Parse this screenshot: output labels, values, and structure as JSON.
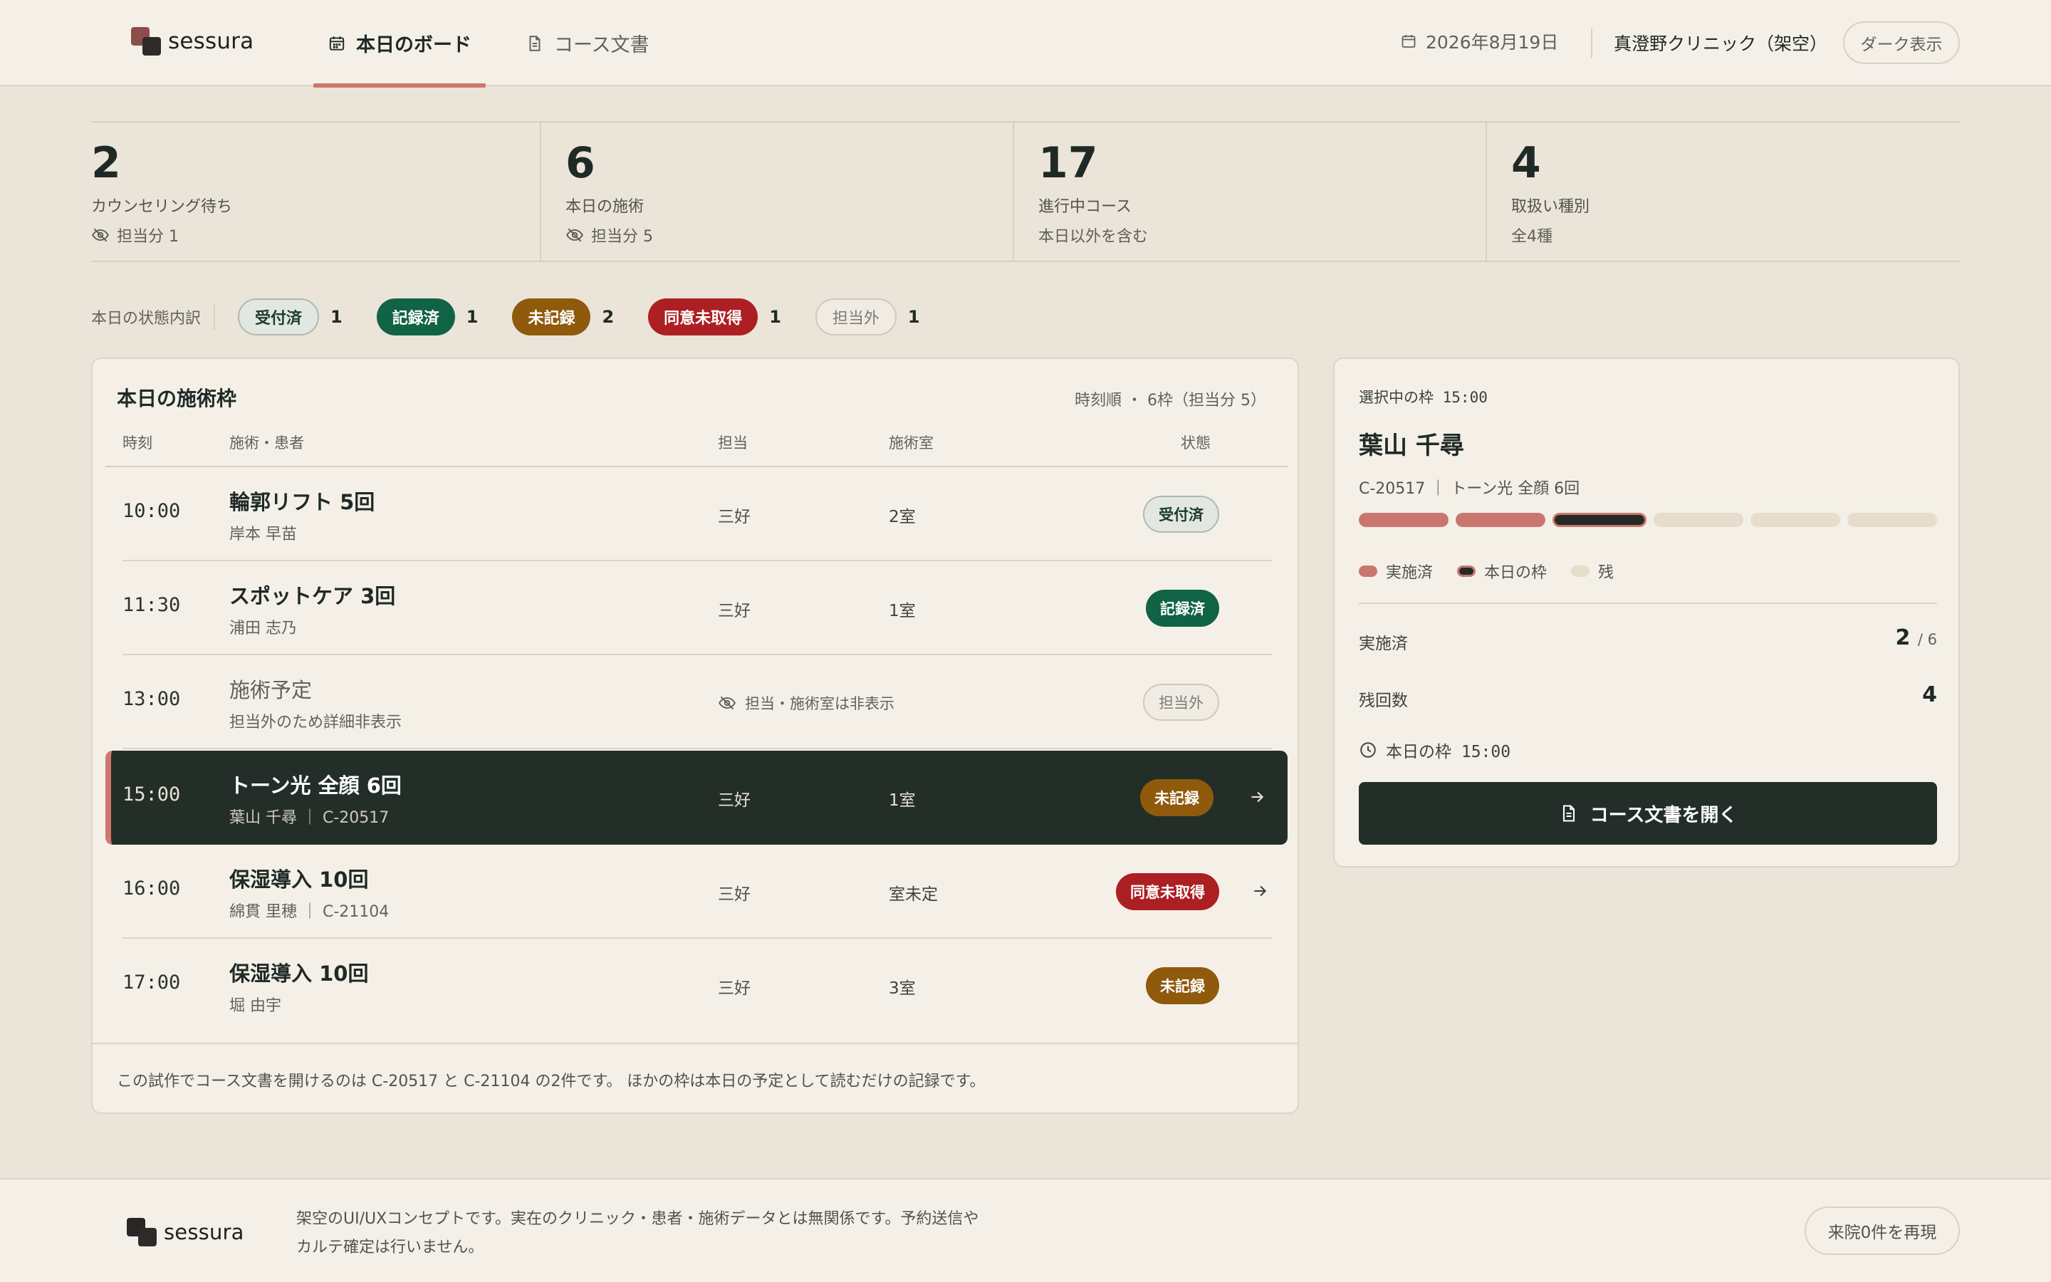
{
  "header": {
    "brand": "sessura",
    "tabs": [
      {
        "label": "本日のボード",
        "icon": "calendar-icon",
        "active": true
      },
      {
        "label": "コース文書",
        "icon": "document-icon",
        "active": false
      }
    ],
    "date": "2026年8月19日",
    "clinic": "真澄野クリニック（架空）",
    "dark_mode_label": "ダーク表示"
  },
  "stats": [
    {
      "value": "2",
      "label": "カウンセリング待ち",
      "sub": "担当分 1",
      "sub_icon": "eye-off-icon"
    },
    {
      "value": "6",
      "label": "本日の施術",
      "sub": "担当分 5",
      "sub_icon": "eye-off-icon"
    },
    {
      "value": "17",
      "label": "進行中コース",
      "sub": "本日以外を含む"
    },
    {
      "value": "4",
      "label": "取扱い種別",
      "sub": "全4種"
    }
  ],
  "status_summary": {
    "title": "本日の状態内訳",
    "items": [
      {
        "label": "受付済",
        "count": "1",
        "kind": "received"
      },
      {
        "label": "記録済",
        "count": "1",
        "kind": "recorded"
      },
      {
        "label": "未記録",
        "count": "2",
        "kind": "unrecorded"
      },
      {
        "label": "同意未取得",
        "count": "1",
        "kind": "noconsent"
      },
      {
        "label": "担当外",
        "count": "1",
        "kind": "outside"
      }
    ]
  },
  "schedule": {
    "title": "本日の施術枠",
    "meta": "時刻順 ・ 6枠（担当分 5）",
    "columns": {
      "time": "時刻",
      "treatment": "施術・患者",
      "staff": "担当",
      "room": "施術室",
      "state": "状態"
    },
    "rows": [
      {
        "time": "10:00",
        "treatment": "輪郭リフト 5回",
        "patient": "岸本 早苗",
        "staff": "三好",
        "room": "2室",
        "state": "受付済",
        "kind": "received"
      },
      {
        "time": "11:30",
        "treatment": "スポットケア 3回",
        "patient": "浦田 志乃",
        "staff": "三好",
        "room": "1室",
        "state": "記録済",
        "kind": "recorded"
      },
      {
        "time": "13:00",
        "treatment": "施術予定",
        "patient": "担当外のため詳細非表示",
        "hidden_note": "担当・施術室は非表示",
        "state": "担当外",
        "kind": "outside"
      },
      {
        "time": "15:00",
        "treatment": "トーン光 全顔 6回",
        "patient": "葉山 千尋 ｜ C-20517",
        "staff": "三好",
        "room": "1室",
        "state": "未記録",
        "kind": "unrecorded",
        "selected": true
      },
      {
        "time": "16:00",
        "treatment": "保湿導入 10回",
        "patient": "綿貫 里穂 ｜ C-21104",
        "staff": "三好",
        "room": "室未定",
        "state": "同意未取得",
        "kind": "noconsent"
      },
      {
        "time": "17:00",
        "treatment": "保湿導入 10回",
        "patient": "堀 由宇",
        "staff": "三好",
        "room": "3室",
        "state": "未記録",
        "kind": "unrecorded"
      }
    ],
    "footnote": "この試作でコース文書を開けるのは C-20517 と C-21104 の2件です。 ほかの枠は本日の予定として読むだけの記録です。"
  },
  "detail": {
    "eyebrow": "選択中の枠 15:00",
    "patient": "葉山 千尋",
    "sub": "C-20517 ｜ トーン光 全顔 6回",
    "sessions_total": 6,
    "sessions_done": 2,
    "today_session": 3,
    "legend": {
      "done": "実施済",
      "today": "本日の枠",
      "rest": "残"
    },
    "done_label": "実施済",
    "done_value": "2",
    "done_total": "/ 6",
    "remaining_label": "残回数",
    "remaining_value": "4",
    "slot": "本日の枠 15:00",
    "open_button": "コース文書を開く"
  },
  "footer": {
    "brand": "sessura",
    "disclaimer": "架空のUI/UXコンセプトです。実在のクリニック・患者・施術データとは無関係です。予約送信やカルテ確定は行いません。",
    "replay_label": "来院0件を再現"
  }
}
